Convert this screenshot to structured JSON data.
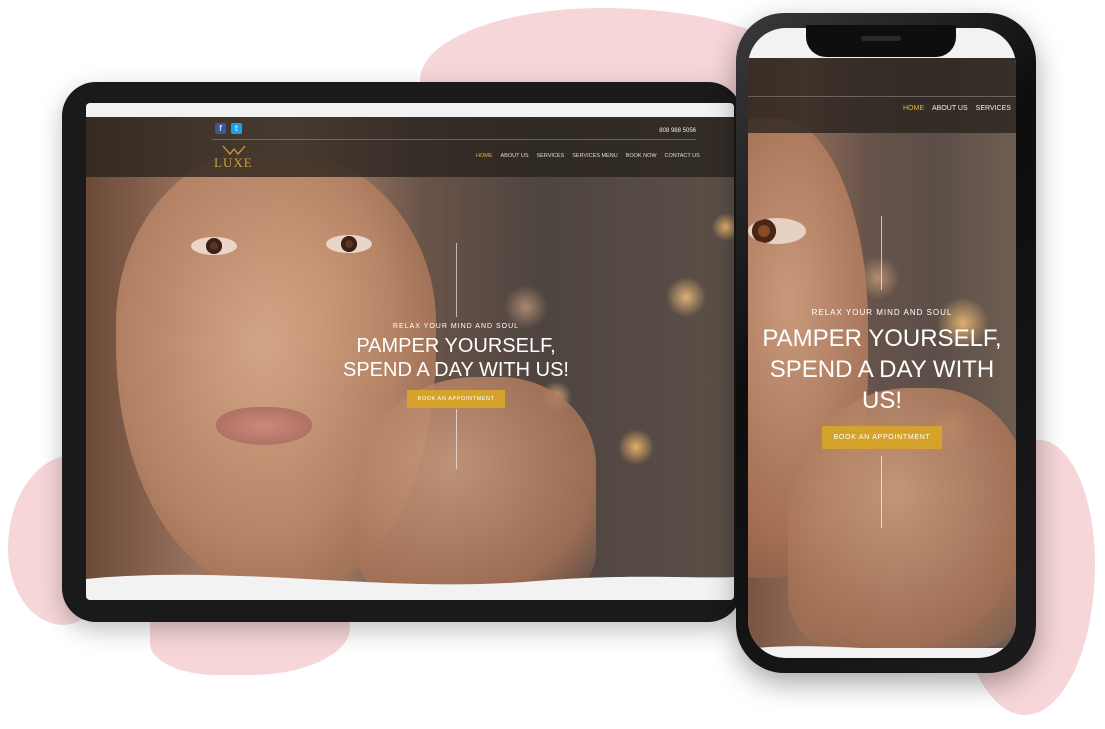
{
  "colors": {
    "accent": "#d6a32a",
    "nav_active": "#e0b33a",
    "logo": "#c9a13a",
    "blob": "#f4cfd1",
    "facebook": "#3b5998",
    "twitter": "#1da1f2"
  },
  "tablet": {
    "header": {
      "phone": "808 988 5056",
      "logo_text": "LUXE",
      "social": [
        {
          "name": "facebook",
          "glyph": "f"
        },
        {
          "name": "twitter",
          "glyph": "t"
        }
      ],
      "nav": [
        "HOME",
        "ABOUT US",
        "SERVICES",
        "SERVICES MENU",
        "BOOK NOW",
        "CONTACT US"
      ],
      "active_nav": "HOME"
    },
    "hero": {
      "eyebrow": "RELAX YOUR MIND AND SOUL",
      "title_line1": "PAMPER YOURSELF,",
      "title_line2": "SPEND A DAY WITH US!",
      "cta": "BOOK AN APPOINTMENT"
    }
  },
  "phone": {
    "nav": [
      "HOME",
      "ABOUT US",
      "SERVICES"
    ],
    "active_nav": "HOME",
    "hero": {
      "eyebrow": "RELAX YOUR MIND AND SOUL",
      "title_line1": "PAMPER YOURSELF,",
      "title_line2": "SPEND A DAY WITH US!",
      "cta": "BOOK AN APPOINTMENT"
    }
  }
}
